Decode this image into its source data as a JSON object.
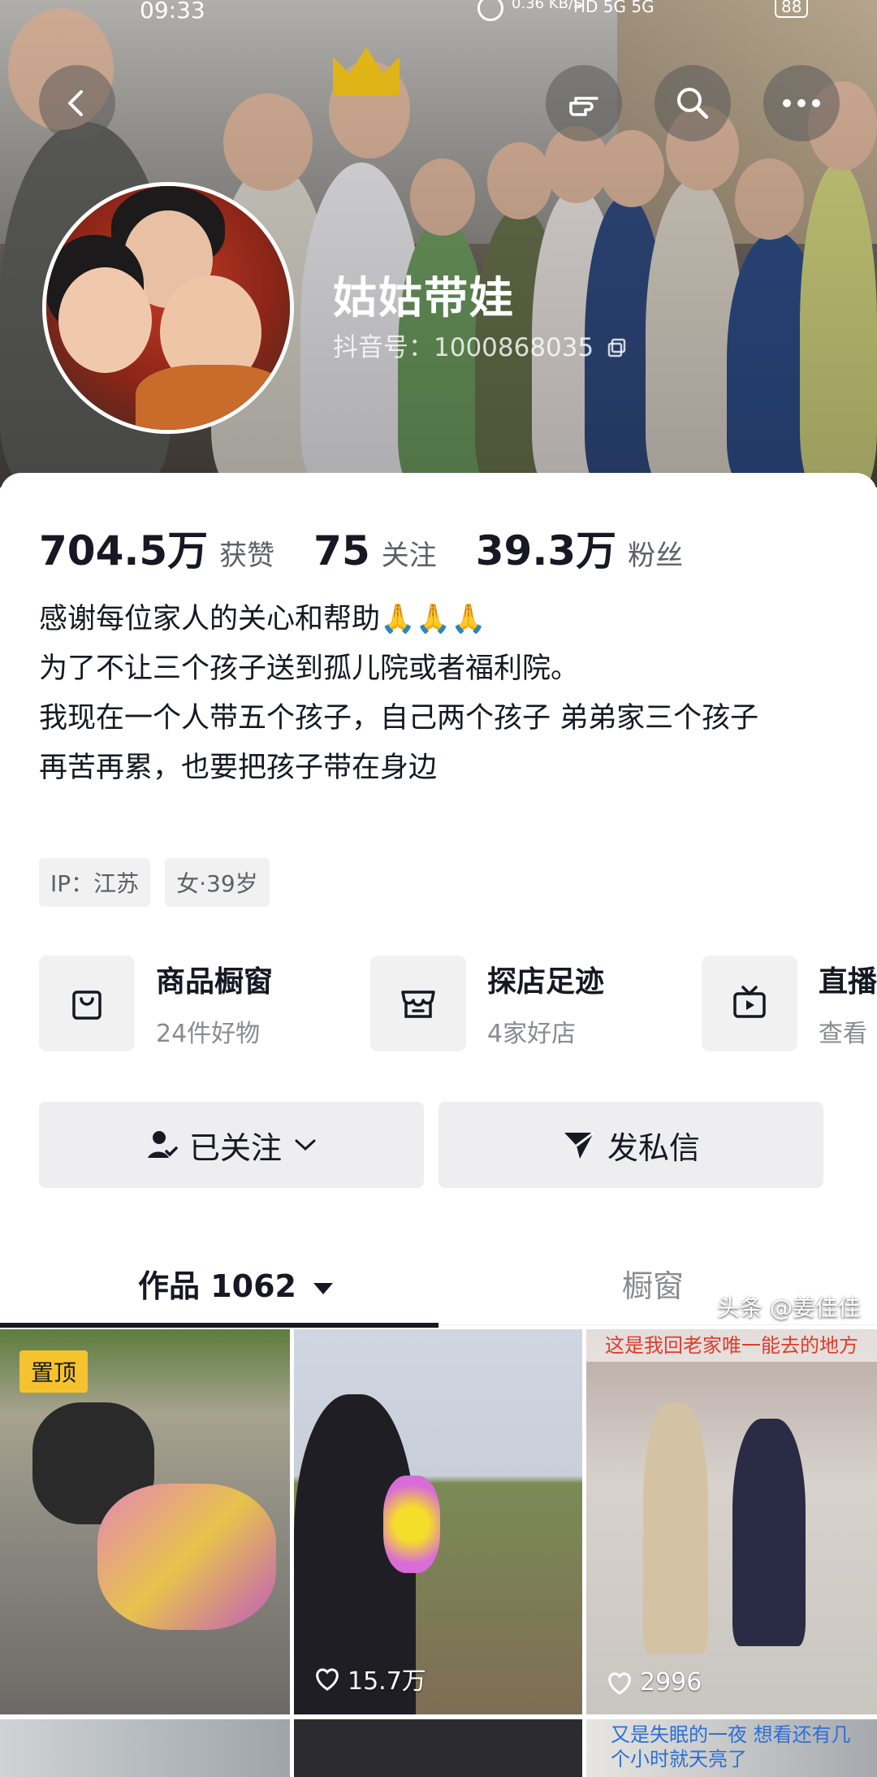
{
  "status_bar": {
    "time": "09:33",
    "speed": "0.36 KB/S",
    "icons": "HD 5G 5G",
    "battery": "88"
  },
  "header": {
    "back_icon": "chevron-left-icon",
    "gesture_icon": "hand-pointer-icon",
    "search_icon": "search-icon",
    "more_icon": "more-icon"
  },
  "profile": {
    "name": "姑姑带娃",
    "douyin_id": "抖音号：1000868035"
  },
  "stats": [
    {
      "num": "704.5万",
      "label": "获赞"
    },
    {
      "num": "75",
      "label": "关注"
    },
    {
      "num": "39.3万",
      "label": "粉丝"
    }
  ],
  "bio": [
    "感谢每位家人的关心和帮助🙏🙏🙏",
    "为了不让三个孩子送到孤儿院或者福利院。",
    "我现在一个人带五个孩子，自己两个孩子 弟弟家三个孩子",
    "再苦再累，也要把孩子带在身边"
  ],
  "tags": [
    "IP：江苏",
    "女·39岁"
  ],
  "services": [
    {
      "title": "商品橱窗",
      "sub": "24件好物",
      "icon": "shopping-bag-icon"
    },
    {
      "title": "探店足迹",
      "sub": "4家好店",
      "icon": "store-icon"
    },
    {
      "title": "直播",
      "sub": "查看",
      "icon": "tv-play-icon"
    }
  ],
  "actions": {
    "followed": "已关注",
    "message": "发私信"
  },
  "tabs": {
    "works": "作品 1062",
    "showcase": "橱窗"
  },
  "videos": [
    {
      "pinned": "置顶",
      "likes": ""
    },
    {
      "likes": "15.7万"
    },
    {
      "likes": "2996",
      "overlay": "这是我回老家唯一能去的地方"
    },
    {
      "likes": ""
    },
    {
      "likes": ""
    },
    {
      "likes": "",
      "overlay": "又是失眠的一夜 想看还有几个小时就天亮了"
    }
  ],
  "watermark": "头条 @姜佳佳",
  "colors": {
    "text": "#161823",
    "muted": "#5e6068",
    "chip": "#f1f1f2",
    "pin": "#f6c22e"
  }
}
